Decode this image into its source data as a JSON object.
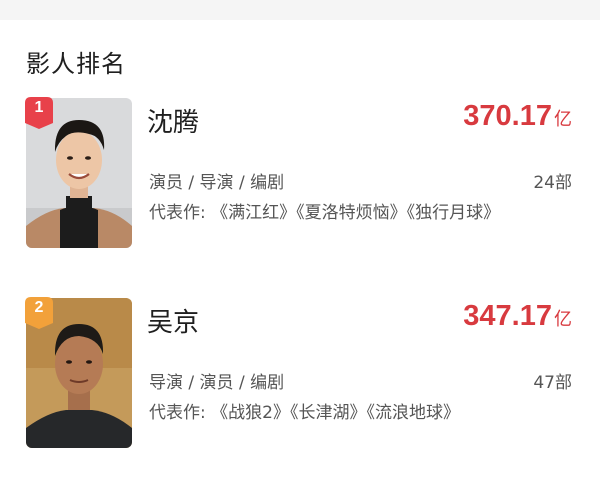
{
  "section": {
    "title": "影人排名"
  },
  "people": [
    {
      "rank": "1",
      "name": "沈腾",
      "box_office": "370.17",
      "box_unit": "亿",
      "roles": "演员 / 导演 / 编剧",
      "count": "24部",
      "works": "代表作: 《满江红》《夏洛特烦恼》《独行月球》",
      "rank_color": "#e8414a"
    },
    {
      "rank": "2",
      "name": "吴京",
      "box_office": "347.17",
      "box_unit": "亿",
      "roles": "导演 / 演员 / 编剧",
      "count": "47部",
      "works": "代表作: 《战狼2》《长津湖》《流浪地球》",
      "rank_color": "#f2a13a"
    }
  ],
  "colors": {
    "accent": "#d83a3f",
    "text": "#1f1f1f",
    "subtext": "#555555"
  }
}
